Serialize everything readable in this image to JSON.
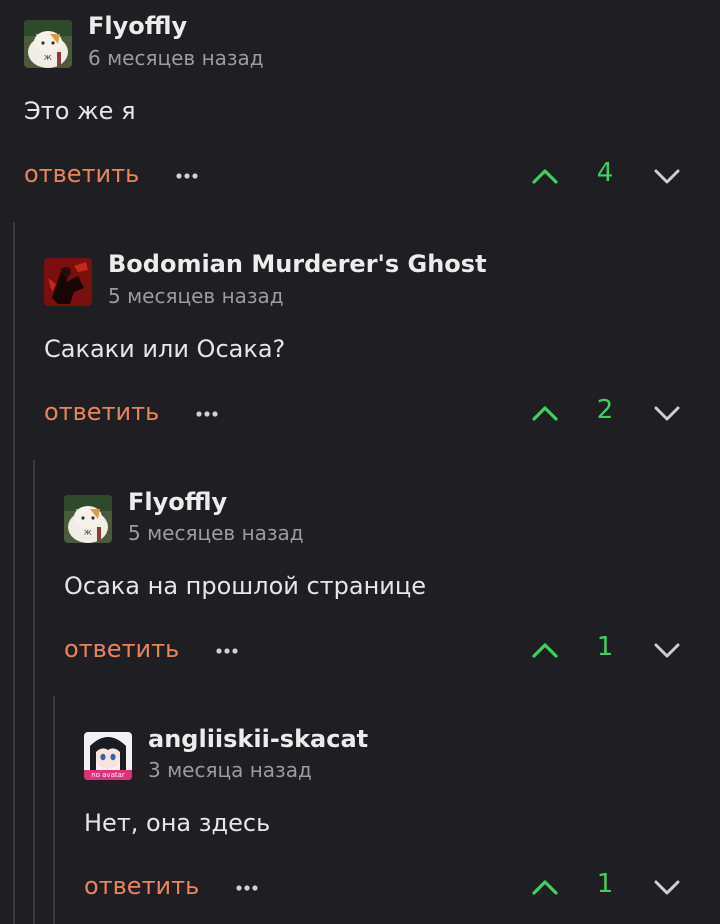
{
  "comments": [
    {
      "author": "Flyoffly",
      "time": "6 месяцев назад",
      "text": "Это же я",
      "reply_label": "ответить",
      "votes": "4",
      "avatar": "cat-avatar"
    },
    {
      "author": "Bodomian Murderer's Ghost",
      "time": "5 месяцев назад",
      "text": "Сакаки или Осака?",
      "reply_label": "ответить",
      "votes": "2",
      "avatar": "red-figure-avatar"
    },
    {
      "author": "Flyoffly",
      "time": "5 месяцев назад",
      "text": "Осака на прошлой странице",
      "reply_label": "ответить",
      "votes": "1",
      "avatar": "cat-avatar"
    },
    {
      "author": "angliiskii-skacat",
      "time": "3 месяца назад",
      "text": "Нет, она здесь",
      "reply_label": "ответить",
      "votes": "1",
      "avatar": "anime-girl-avatar",
      "avatar_caption": "no avatar"
    }
  ],
  "colors": {
    "background": "#1f1f23",
    "reply": "#e8845a",
    "vote": "#3fd05f",
    "muted": "#9a9a9f"
  }
}
